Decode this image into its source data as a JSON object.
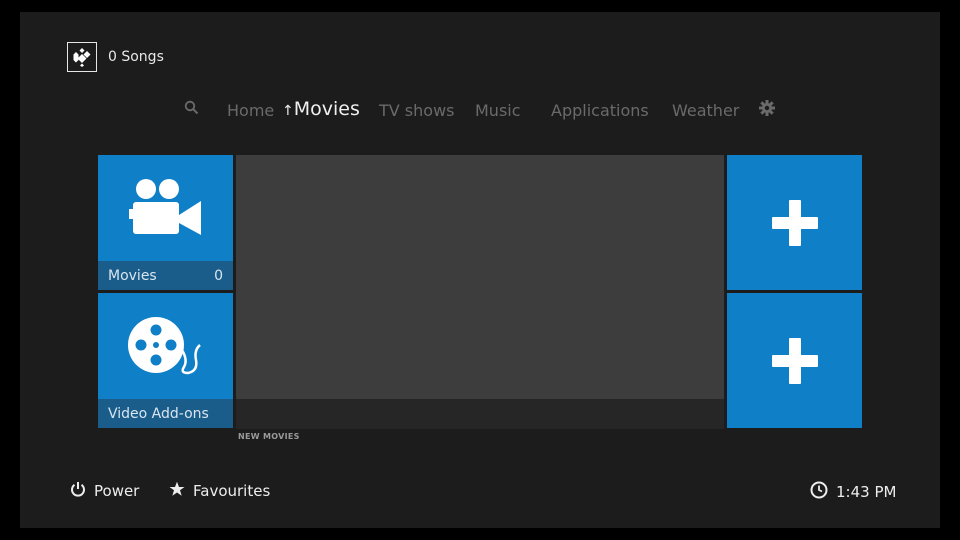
{
  "header": {
    "status_text": "0 Songs",
    "logo_icon": "kodi-logo-icon"
  },
  "nav": {
    "search_icon": "search-icon",
    "items": [
      {
        "label": "Home"
      },
      {
        "label": "Movies",
        "prefix": "↑",
        "active": true
      },
      {
        "label": "TV shows"
      },
      {
        "label": "Music"
      },
      {
        "label": "Applications"
      },
      {
        "label": "Weather"
      }
    ],
    "settings_icon": "gear-icon"
  },
  "tiles": {
    "movies": {
      "label": "Movies",
      "count": "0",
      "icon": "movie-camera-icon"
    },
    "video_addons": {
      "label": "Video Add-ons",
      "icon": "film-reel-icon"
    },
    "add_top": {
      "icon": "plus-icon"
    },
    "add_bottom": {
      "icon": "plus-icon"
    }
  },
  "section": {
    "label": "NEW MOVIES"
  },
  "footer": {
    "power_label": "Power",
    "favourites_label": "Favourites",
    "clock": "1:43 PM"
  },
  "colors": {
    "tile_blue": "#0f7fc8",
    "label_band": "#1a5c8a",
    "background": "#1c1c1c"
  }
}
